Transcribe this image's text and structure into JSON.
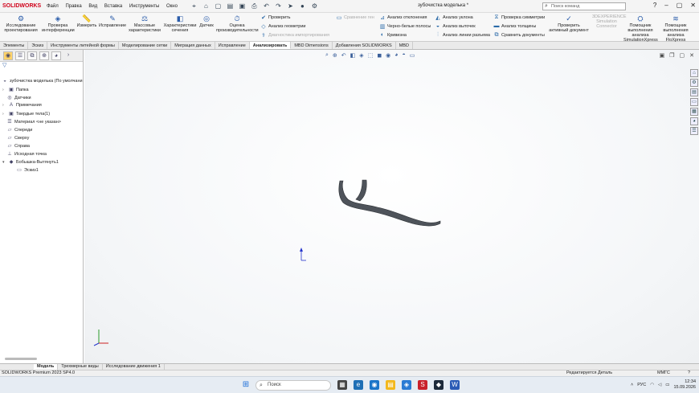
{
  "app": {
    "brand": "SOLIDWORKS",
    "doc_title": "зубочистка моделька *",
    "search_placeholder": "Поиск команд"
  },
  "menu": [
    "Файл",
    "Правка",
    "Вид",
    "Вставка",
    "Инструменты",
    "Окно"
  ],
  "ribbon": {
    "buttons": [
      {
        "label": "Исследование проектирования",
        "icon": "study-icon"
      },
      {
        "label": "Проверка интерференции",
        "icon": "interference-icon"
      },
      {
        "label": "Измерить",
        "icon": "measure-icon"
      },
      {
        "label": "Исправление",
        "icon": "repair-icon"
      },
      {
        "label": "Массовые характеристики",
        "icon": "mass-props-icon"
      },
      {
        "label": "Характеристики сечения",
        "icon": "section-props-icon"
      },
      {
        "label": "Датчик",
        "icon": "sensor-icon"
      },
      {
        "label": "Оценка производительности",
        "icon": "performance-icon"
      }
    ],
    "small_col1": [
      "Проверить",
      "Анализ геометрии",
      "Диагностика импортирования"
    ],
    "compare_label": "Сравнение ген",
    "small_col2": [
      "Анализ отклонения",
      "Черно-белые полосы",
      "Кривизна"
    ],
    "small_col3": [
      "Анализ уклона",
      "Анализ выточек",
      "Анализ линии разъема"
    ],
    "small_col4": [
      "Проверка симметрии",
      "Анализ толщины",
      "Сравнить документы"
    ],
    "check_active": "Проверить активный документ",
    "simulation": {
      "brand": "3DEXPERIENCE",
      "line1": "Simulation",
      "line2": "Connector"
    },
    "sim_xpress": "Помощник выполнения анализа SimulationXpress",
    "floxpress": "Помощник выполнения анализа FloXpress"
  },
  "tabs": [
    "Элементы",
    "Эскиз",
    "Инструменты литейной формы",
    "Моделирование сетки",
    "Миграция данных",
    "Исправление",
    "Анализировать",
    "MBD Dimensions",
    "Добавления SOLIDWORKS",
    "MBD"
  ],
  "tree": {
    "root": "зубочистка моделька  (По умолчани",
    "items": [
      "Папка",
      "Датчики",
      "Примечания",
      "Твердые тела(1)",
      "Материал <не указан>",
      "Спереди",
      "Сверху",
      "Справа",
      "Исходная точка",
      "Бобышка-Вытянуть1",
      "Эскиз1"
    ]
  },
  "bottom_tabs": [
    "Модель",
    "Трехмерные виды",
    "Исследование движения 1"
  ],
  "status": {
    "version": "SOLIDWORKS Premium 2023 SP4.0",
    "editing": "Редактируется Деталь",
    "units": "ММГС"
  },
  "taskbar": {
    "search": "Поиск",
    "lang": "РУС",
    "time": "12:34",
    "date": "15.09.2026"
  }
}
